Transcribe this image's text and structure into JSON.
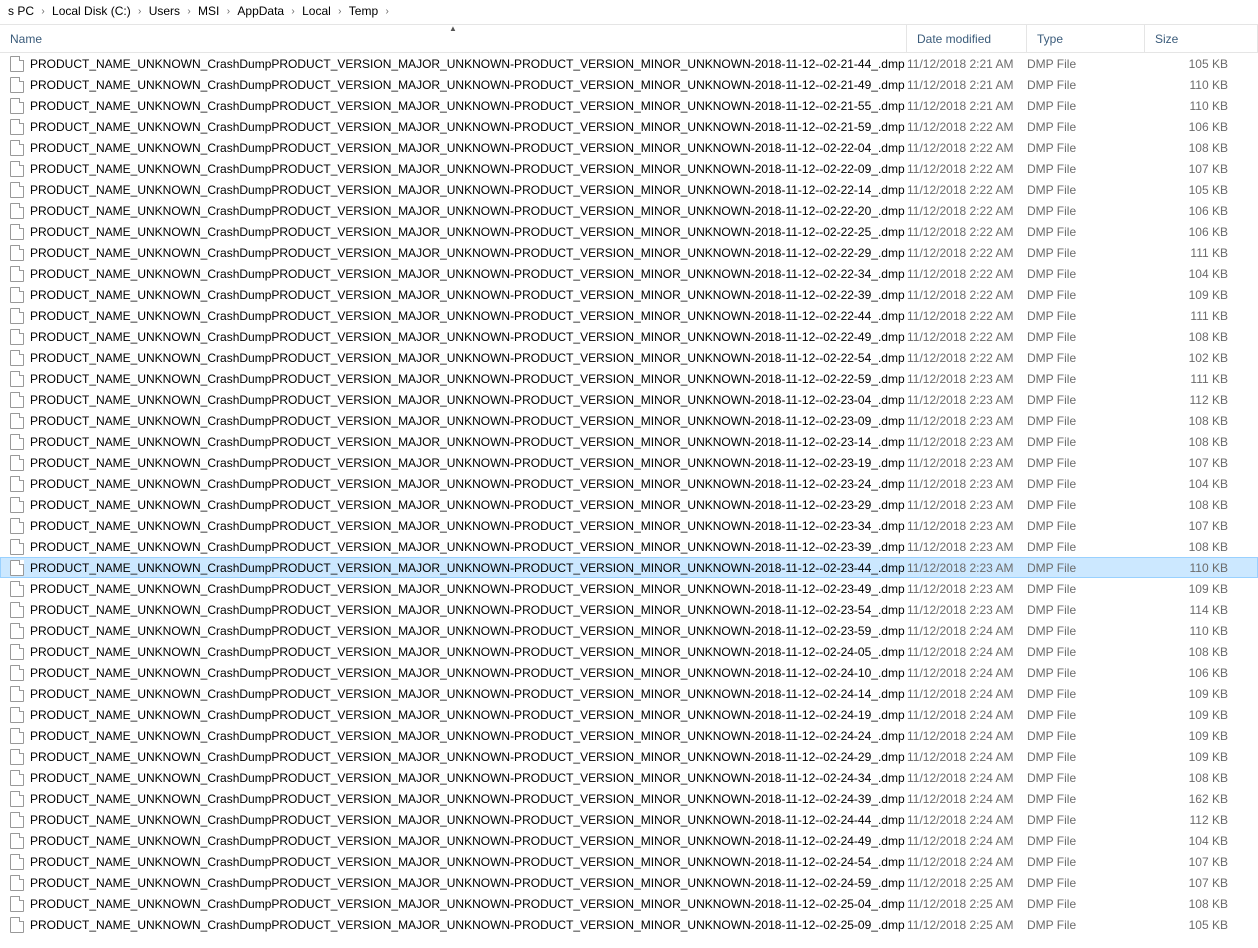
{
  "breadcrumb": [
    "s PC",
    "Local Disk (C:)",
    "Users",
    "MSI",
    "AppData",
    "Local",
    "Temp"
  ],
  "columns": {
    "name": "Name",
    "date": "Date modified",
    "type": "Type",
    "size": "Size"
  },
  "selected_index": 24,
  "files": [
    {
      "name": "PRODUCT_NAME_UNKNOWN_CrashDumpPRODUCT_VERSION_MAJOR_UNKNOWN-PRODUCT_VERSION_MINOR_UNKNOWN-2018-11-12--02-21-44_.dmp",
      "date": "11/12/2018 2:21 AM",
      "type": "DMP File",
      "size": "105 KB"
    },
    {
      "name": "PRODUCT_NAME_UNKNOWN_CrashDumpPRODUCT_VERSION_MAJOR_UNKNOWN-PRODUCT_VERSION_MINOR_UNKNOWN-2018-11-12--02-21-49_.dmp",
      "date": "11/12/2018 2:21 AM",
      "type": "DMP File",
      "size": "110 KB"
    },
    {
      "name": "PRODUCT_NAME_UNKNOWN_CrashDumpPRODUCT_VERSION_MAJOR_UNKNOWN-PRODUCT_VERSION_MINOR_UNKNOWN-2018-11-12--02-21-55_.dmp",
      "date": "11/12/2018 2:21 AM",
      "type": "DMP File",
      "size": "110 KB"
    },
    {
      "name": "PRODUCT_NAME_UNKNOWN_CrashDumpPRODUCT_VERSION_MAJOR_UNKNOWN-PRODUCT_VERSION_MINOR_UNKNOWN-2018-11-12--02-21-59_.dmp",
      "date": "11/12/2018 2:22 AM",
      "type": "DMP File",
      "size": "106 KB"
    },
    {
      "name": "PRODUCT_NAME_UNKNOWN_CrashDumpPRODUCT_VERSION_MAJOR_UNKNOWN-PRODUCT_VERSION_MINOR_UNKNOWN-2018-11-12--02-22-04_.dmp",
      "date": "11/12/2018 2:22 AM",
      "type": "DMP File",
      "size": "108 KB"
    },
    {
      "name": "PRODUCT_NAME_UNKNOWN_CrashDumpPRODUCT_VERSION_MAJOR_UNKNOWN-PRODUCT_VERSION_MINOR_UNKNOWN-2018-11-12--02-22-09_.dmp",
      "date": "11/12/2018 2:22 AM",
      "type": "DMP File",
      "size": "107 KB"
    },
    {
      "name": "PRODUCT_NAME_UNKNOWN_CrashDumpPRODUCT_VERSION_MAJOR_UNKNOWN-PRODUCT_VERSION_MINOR_UNKNOWN-2018-11-12--02-22-14_.dmp",
      "date": "11/12/2018 2:22 AM",
      "type": "DMP File",
      "size": "105 KB"
    },
    {
      "name": "PRODUCT_NAME_UNKNOWN_CrashDumpPRODUCT_VERSION_MAJOR_UNKNOWN-PRODUCT_VERSION_MINOR_UNKNOWN-2018-11-12--02-22-20_.dmp",
      "date": "11/12/2018 2:22 AM",
      "type": "DMP File",
      "size": "106 KB"
    },
    {
      "name": "PRODUCT_NAME_UNKNOWN_CrashDumpPRODUCT_VERSION_MAJOR_UNKNOWN-PRODUCT_VERSION_MINOR_UNKNOWN-2018-11-12--02-22-25_.dmp",
      "date": "11/12/2018 2:22 AM",
      "type": "DMP File",
      "size": "106 KB"
    },
    {
      "name": "PRODUCT_NAME_UNKNOWN_CrashDumpPRODUCT_VERSION_MAJOR_UNKNOWN-PRODUCT_VERSION_MINOR_UNKNOWN-2018-11-12--02-22-29_.dmp",
      "date": "11/12/2018 2:22 AM",
      "type": "DMP File",
      "size": "111 KB"
    },
    {
      "name": "PRODUCT_NAME_UNKNOWN_CrashDumpPRODUCT_VERSION_MAJOR_UNKNOWN-PRODUCT_VERSION_MINOR_UNKNOWN-2018-11-12--02-22-34_.dmp",
      "date": "11/12/2018 2:22 AM",
      "type": "DMP File",
      "size": "104 KB"
    },
    {
      "name": "PRODUCT_NAME_UNKNOWN_CrashDumpPRODUCT_VERSION_MAJOR_UNKNOWN-PRODUCT_VERSION_MINOR_UNKNOWN-2018-11-12--02-22-39_.dmp",
      "date": "11/12/2018 2:22 AM",
      "type": "DMP File",
      "size": "109 KB"
    },
    {
      "name": "PRODUCT_NAME_UNKNOWN_CrashDumpPRODUCT_VERSION_MAJOR_UNKNOWN-PRODUCT_VERSION_MINOR_UNKNOWN-2018-11-12--02-22-44_.dmp",
      "date": "11/12/2018 2:22 AM",
      "type": "DMP File",
      "size": "111 KB"
    },
    {
      "name": "PRODUCT_NAME_UNKNOWN_CrashDumpPRODUCT_VERSION_MAJOR_UNKNOWN-PRODUCT_VERSION_MINOR_UNKNOWN-2018-11-12--02-22-49_.dmp",
      "date": "11/12/2018 2:22 AM",
      "type": "DMP File",
      "size": "108 KB"
    },
    {
      "name": "PRODUCT_NAME_UNKNOWN_CrashDumpPRODUCT_VERSION_MAJOR_UNKNOWN-PRODUCT_VERSION_MINOR_UNKNOWN-2018-11-12--02-22-54_.dmp",
      "date": "11/12/2018 2:22 AM",
      "type": "DMP File",
      "size": "102 KB"
    },
    {
      "name": "PRODUCT_NAME_UNKNOWN_CrashDumpPRODUCT_VERSION_MAJOR_UNKNOWN-PRODUCT_VERSION_MINOR_UNKNOWN-2018-11-12--02-22-59_.dmp",
      "date": "11/12/2018 2:23 AM",
      "type": "DMP File",
      "size": "111 KB"
    },
    {
      "name": "PRODUCT_NAME_UNKNOWN_CrashDumpPRODUCT_VERSION_MAJOR_UNKNOWN-PRODUCT_VERSION_MINOR_UNKNOWN-2018-11-12--02-23-04_.dmp",
      "date": "11/12/2018 2:23 AM",
      "type": "DMP File",
      "size": "112 KB"
    },
    {
      "name": "PRODUCT_NAME_UNKNOWN_CrashDumpPRODUCT_VERSION_MAJOR_UNKNOWN-PRODUCT_VERSION_MINOR_UNKNOWN-2018-11-12--02-23-09_.dmp",
      "date": "11/12/2018 2:23 AM",
      "type": "DMP File",
      "size": "108 KB"
    },
    {
      "name": "PRODUCT_NAME_UNKNOWN_CrashDumpPRODUCT_VERSION_MAJOR_UNKNOWN-PRODUCT_VERSION_MINOR_UNKNOWN-2018-11-12--02-23-14_.dmp",
      "date": "11/12/2018 2:23 AM",
      "type": "DMP File",
      "size": "108 KB"
    },
    {
      "name": "PRODUCT_NAME_UNKNOWN_CrashDumpPRODUCT_VERSION_MAJOR_UNKNOWN-PRODUCT_VERSION_MINOR_UNKNOWN-2018-11-12--02-23-19_.dmp",
      "date": "11/12/2018 2:23 AM",
      "type": "DMP File",
      "size": "107 KB"
    },
    {
      "name": "PRODUCT_NAME_UNKNOWN_CrashDumpPRODUCT_VERSION_MAJOR_UNKNOWN-PRODUCT_VERSION_MINOR_UNKNOWN-2018-11-12--02-23-24_.dmp",
      "date": "11/12/2018 2:23 AM",
      "type": "DMP File",
      "size": "104 KB"
    },
    {
      "name": "PRODUCT_NAME_UNKNOWN_CrashDumpPRODUCT_VERSION_MAJOR_UNKNOWN-PRODUCT_VERSION_MINOR_UNKNOWN-2018-11-12--02-23-29_.dmp",
      "date": "11/12/2018 2:23 AM",
      "type": "DMP File",
      "size": "108 KB"
    },
    {
      "name": "PRODUCT_NAME_UNKNOWN_CrashDumpPRODUCT_VERSION_MAJOR_UNKNOWN-PRODUCT_VERSION_MINOR_UNKNOWN-2018-11-12--02-23-34_.dmp",
      "date": "11/12/2018 2:23 AM",
      "type": "DMP File",
      "size": "107 KB"
    },
    {
      "name": "PRODUCT_NAME_UNKNOWN_CrashDumpPRODUCT_VERSION_MAJOR_UNKNOWN-PRODUCT_VERSION_MINOR_UNKNOWN-2018-11-12--02-23-39_.dmp",
      "date": "11/12/2018 2:23 AM",
      "type": "DMP File",
      "size": "108 KB"
    },
    {
      "name": "PRODUCT_NAME_UNKNOWN_CrashDumpPRODUCT_VERSION_MAJOR_UNKNOWN-PRODUCT_VERSION_MINOR_UNKNOWN-2018-11-12--02-23-44_.dmp",
      "date": "11/12/2018 2:23 AM",
      "type": "DMP File",
      "size": "110 KB"
    },
    {
      "name": "PRODUCT_NAME_UNKNOWN_CrashDumpPRODUCT_VERSION_MAJOR_UNKNOWN-PRODUCT_VERSION_MINOR_UNKNOWN-2018-11-12--02-23-49_.dmp",
      "date": "11/12/2018 2:23 AM",
      "type": "DMP File",
      "size": "109 KB"
    },
    {
      "name": "PRODUCT_NAME_UNKNOWN_CrashDumpPRODUCT_VERSION_MAJOR_UNKNOWN-PRODUCT_VERSION_MINOR_UNKNOWN-2018-11-12--02-23-54_.dmp",
      "date": "11/12/2018 2:23 AM",
      "type": "DMP File",
      "size": "114 KB"
    },
    {
      "name": "PRODUCT_NAME_UNKNOWN_CrashDumpPRODUCT_VERSION_MAJOR_UNKNOWN-PRODUCT_VERSION_MINOR_UNKNOWN-2018-11-12--02-23-59_.dmp",
      "date": "11/12/2018 2:24 AM",
      "type": "DMP File",
      "size": "110 KB"
    },
    {
      "name": "PRODUCT_NAME_UNKNOWN_CrashDumpPRODUCT_VERSION_MAJOR_UNKNOWN-PRODUCT_VERSION_MINOR_UNKNOWN-2018-11-12--02-24-05_.dmp",
      "date": "11/12/2018 2:24 AM",
      "type": "DMP File",
      "size": "108 KB"
    },
    {
      "name": "PRODUCT_NAME_UNKNOWN_CrashDumpPRODUCT_VERSION_MAJOR_UNKNOWN-PRODUCT_VERSION_MINOR_UNKNOWN-2018-11-12--02-24-10_.dmp",
      "date": "11/12/2018 2:24 AM",
      "type": "DMP File",
      "size": "106 KB"
    },
    {
      "name": "PRODUCT_NAME_UNKNOWN_CrashDumpPRODUCT_VERSION_MAJOR_UNKNOWN-PRODUCT_VERSION_MINOR_UNKNOWN-2018-11-12--02-24-14_.dmp",
      "date": "11/12/2018 2:24 AM",
      "type": "DMP File",
      "size": "109 KB"
    },
    {
      "name": "PRODUCT_NAME_UNKNOWN_CrashDumpPRODUCT_VERSION_MAJOR_UNKNOWN-PRODUCT_VERSION_MINOR_UNKNOWN-2018-11-12--02-24-19_.dmp",
      "date": "11/12/2018 2:24 AM",
      "type": "DMP File",
      "size": "109 KB"
    },
    {
      "name": "PRODUCT_NAME_UNKNOWN_CrashDumpPRODUCT_VERSION_MAJOR_UNKNOWN-PRODUCT_VERSION_MINOR_UNKNOWN-2018-11-12--02-24-24_.dmp",
      "date": "11/12/2018 2:24 AM",
      "type": "DMP File",
      "size": "109 KB"
    },
    {
      "name": "PRODUCT_NAME_UNKNOWN_CrashDumpPRODUCT_VERSION_MAJOR_UNKNOWN-PRODUCT_VERSION_MINOR_UNKNOWN-2018-11-12--02-24-29_.dmp",
      "date": "11/12/2018 2:24 AM",
      "type": "DMP File",
      "size": "109 KB"
    },
    {
      "name": "PRODUCT_NAME_UNKNOWN_CrashDumpPRODUCT_VERSION_MAJOR_UNKNOWN-PRODUCT_VERSION_MINOR_UNKNOWN-2018-11-12--02-24-34_.dmp",
      "date": "11/12/2018 2:24 AM",
      "type": "DMP File",
      "size": "108 KB"
    },
    {
      "name": "PRODUCT_NAME_UNKNOWN_CrashDumpPRODUCT_VERSION_MAJOR_UNKNOWN-PRODUCT_VERSION_MINOR_UNKNOWN-2018-11-12--02-24-39_.dmp",
      "date": "11/12/2018 2:24 AM",
      "type": "DMP File",
      "size": "162 KB"
    },
    {
      "name": "PRODUCT_NAME_UNKNOWN_CrashDumpPRODUCT_VERSION_MAJOR_UNKNOWN-PRODUCT_VERSION_MINOR_UNKNOWN-2018-11-12--02-24-44_.dmp",
      "date": "11/12/2018 2:24 AM",
      "type": "DMP File",
      "size": "112 KB"
    },
    {
      "name": "PRODUCT_NAME_UNKNOWN_CrashDumpPRODUCT_VERSION_MAJOR_UNKNOWN-PRODUCT_VERSION_MINOR_UNKNOWN-2018-11-12--02-24-49_.dmp",
      "date": "11/12/2018 2:24 AM",
      "type": "DMP File",
      "size": "104 KB"
    },
    {
      "name": "PRODUCT_NAME_UNKNOWN_CrashDumpPRODUCT_VERSION_MAJOR_UNKNOWN-PRODUCT_VERSION_MINOR_UNKNOWN-2018-11-12--02-24-54_.dmp",
      "date": "11/12/2018 2:24 AM",
      "type": "DMP File",
      "size": "107 KB"
    },
    {
      "name": "PRODUCT_NAME_UNKNOWN_CrashDumpPRODUCT_VERSION_MAJOR_UNKNOWN-PRODUCT_VERSION_MINOR_UNKNOWN-2018-11-12--02-24-59_.dmp",
      "date": "11/12/2018 2:25 AM",
      "type": "DMP File",
      "size": "107 KB"
    },
    {
      "name": "PRODUCT_NAME_UNKNOWN_CrashDumpPRODUCT_VERSION_MAJOR_UNKNOWN-PRODUCT_VERSION_MINOR_UNKNOWN-2018-11-12--02-25-04_.dmp",
      "date": "11/12/2018 2:25 AM",
      "type": "DMP File",
      "size": "108 KB"
    },
    {
      "name": "PRODUCT_NAME_UNKNOWN_CrashDumpPRODUCT_VERSION_MAJOR_UNKNOWN-PRODUCT_VERSION_MINOR_UNKNOWN-2018-11-12--02-25-09_.dmp",
      "date": "11/12/2018 2:25 AM",
      "type": "DMP File",
      "size": "105 KB"
    }
  ]
}
